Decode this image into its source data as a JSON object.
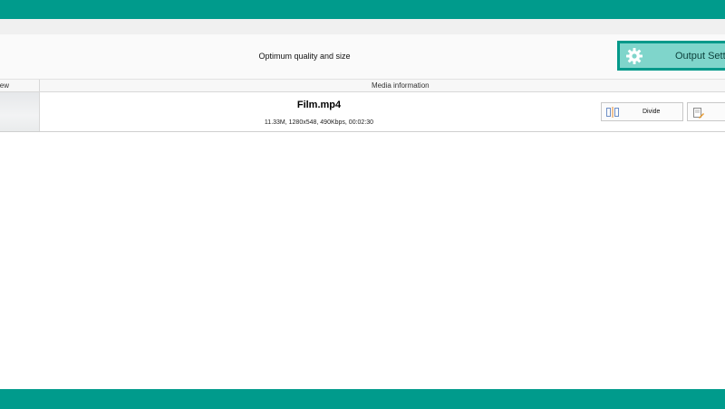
{
  "profile": {
    "description": "Optimum quality and size"
  },
  "output_settings": {
    "label": "Output Setti",
    "icon": "gear-icon"
  },
  "columns": {
    "preview": "view",
    "media_information": "Media information"
  },
  "file": {
    "name": "Film.mp4",
    "details": "11.33M, 1280x548, 490Kbps, 00:02:30"
  },
  "actions": {
    "divide_label": "Divide",
    "divide_icon": "divide-icon",
    "edit_icon": "edit-icon"
  },
  "colors": {
    "accent": "#009b8c",
    "button_fill": "#7fd5cb"
  }
}
